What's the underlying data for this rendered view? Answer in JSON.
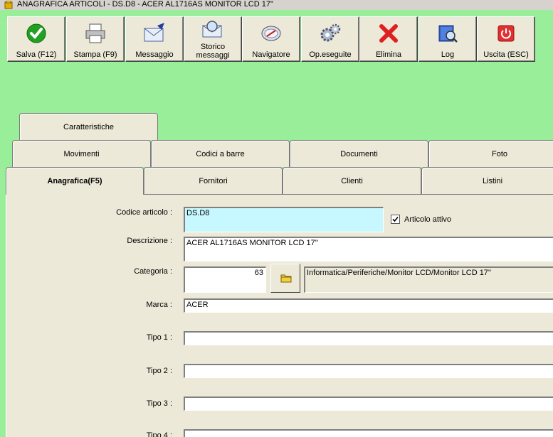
{
  "window": {
    "title": "ANAGRAFICA ARTICOLI - DS.D8 - ACER AL1716AS MONITOR LCD 17\""
  },
  "toolbar": {
    "buttons": [
      {
        "label": "Salva (F12)",
        "icon": "checkmark-icon"
      },
      {
        "label": "Stampa (F9)",
        "icon": "printer-icon"
      },
      {
        "label": "Messaggio",
        "icon": "envelope-pen-icon"
      },
      {
        "label_line1": "Storico",
        "label_line2": "messaggi",
        "icon": "envelope-search-icon"
      },
      {
        "label": "Navigatore",
        "icon": "compass-icon"
      },
      {
        "label": "Op.eseguite",
        "icon": "gears-icon"
      },
      {
        "label": "Elimina",
        "icon": "red-x-icon"
      },
      {
        "label": "Log",
        "icon": "book-search-icon"
      },
      {
        "label": "Uscita (ESC)",
        "icon": "power-icon"
      }
    ]
  },
  "tabs": {
    "row1": [
      "Caratteristiche"
    ],
    "row2": [
      "Movimenti",
      "Codici a barre",
      "Documenti",
      "Foto"
    ],
    "row3": [
      "Anagrafica(F5)",
      "Fornitori",
      "Clienti",
      "Listini"
    ],
    "active": "Anagrafica(F5)"
  },
  "form": {
    "codice_label": "Codice articolo :",
    "codice_value": "DS.D8",
    "attivo_label": "Articolo attivo",
    "attivo_checked": true,
    "descrizione_label": "Descrizione :",
    "descrizione_value": "ACER AL1716AS MONITOR LCD 17''",
    "categoria_label": "Categoria :",
    "categoria_value": "63",
    "categoria_path": "Informatica/Periferiche/Monitor LCD/Monitor LCD 17''",
    "marca_label": "Marca :",
    "marca_value": "ACER",
    "tipo1_label": "Tipo 1 :",
    "tipo1_value": "",
    "tipo2_label": "Tipo 2 :",
    "tipo2_value": "",
    "tipo3_label": "Tipo 3 :",
    "tipo3_value": "",
    "tipo4_label": "Tipo 4 :"
  },
  "colors": {
    "background": "#99ee99",
    "panel": "#ece9d8",
    "code_field": "#c8f8ff"
  }
}
